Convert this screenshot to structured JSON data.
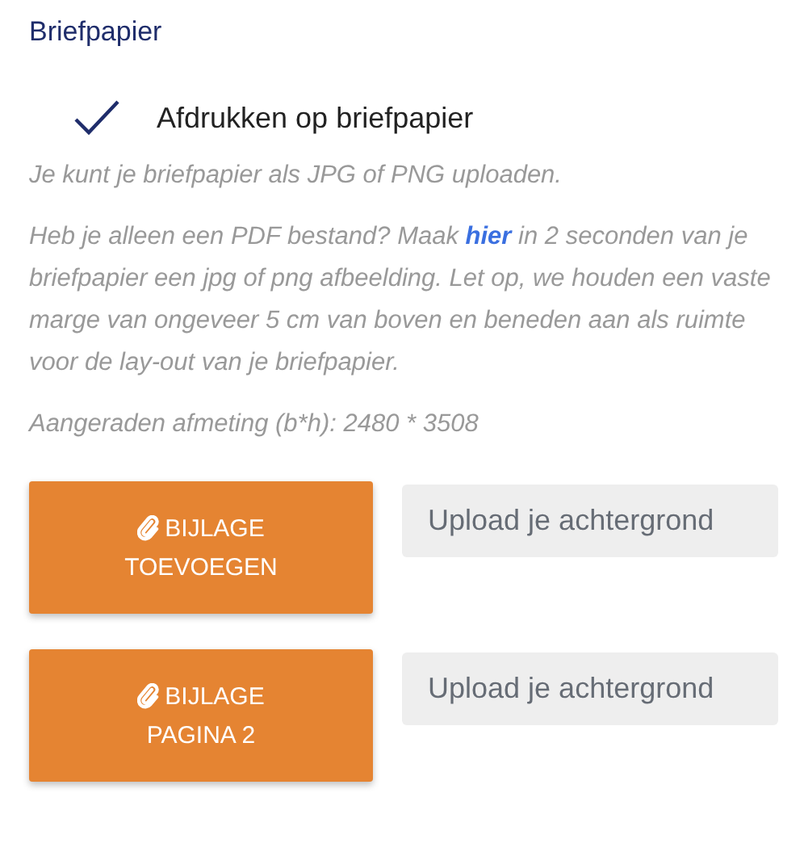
{
  "section_title": "Briefpapier",
  "print_option": {
    "label": "Afdrukken op briefpapier",
    "checked": true
  },
  "info_text": "Je kunt je briefpapier als JPG of PNG uploaden.",
  "pdf_note": {
    "before": "Heb je alleen een PDF bestand? Maak",
    "link": "hier",
    "after": "in 2 seconden van je briefpapier een jpg of png afbeelding. Let op, we houden een vaste marge van ongeveer 5 cm van boven en beneden aan als ruimte voor de lay-out van je briefpapier."
  },
  "size_hint": "Aangeraden afmeting (b*h): 2480 * 3508",
  "uploads": [
    {
      "button_lines": [
        "BIJLAGE",
        "TOEVOEGEN"
      ],
      "placeholder": "Upload je achtergrond"
    },
    {
      "button_lines": [
        "BIJLAGE",
        "PAGINA 2"
      ],
      "placeholder": "Upload je achtergrond"
    }
  ]
}
